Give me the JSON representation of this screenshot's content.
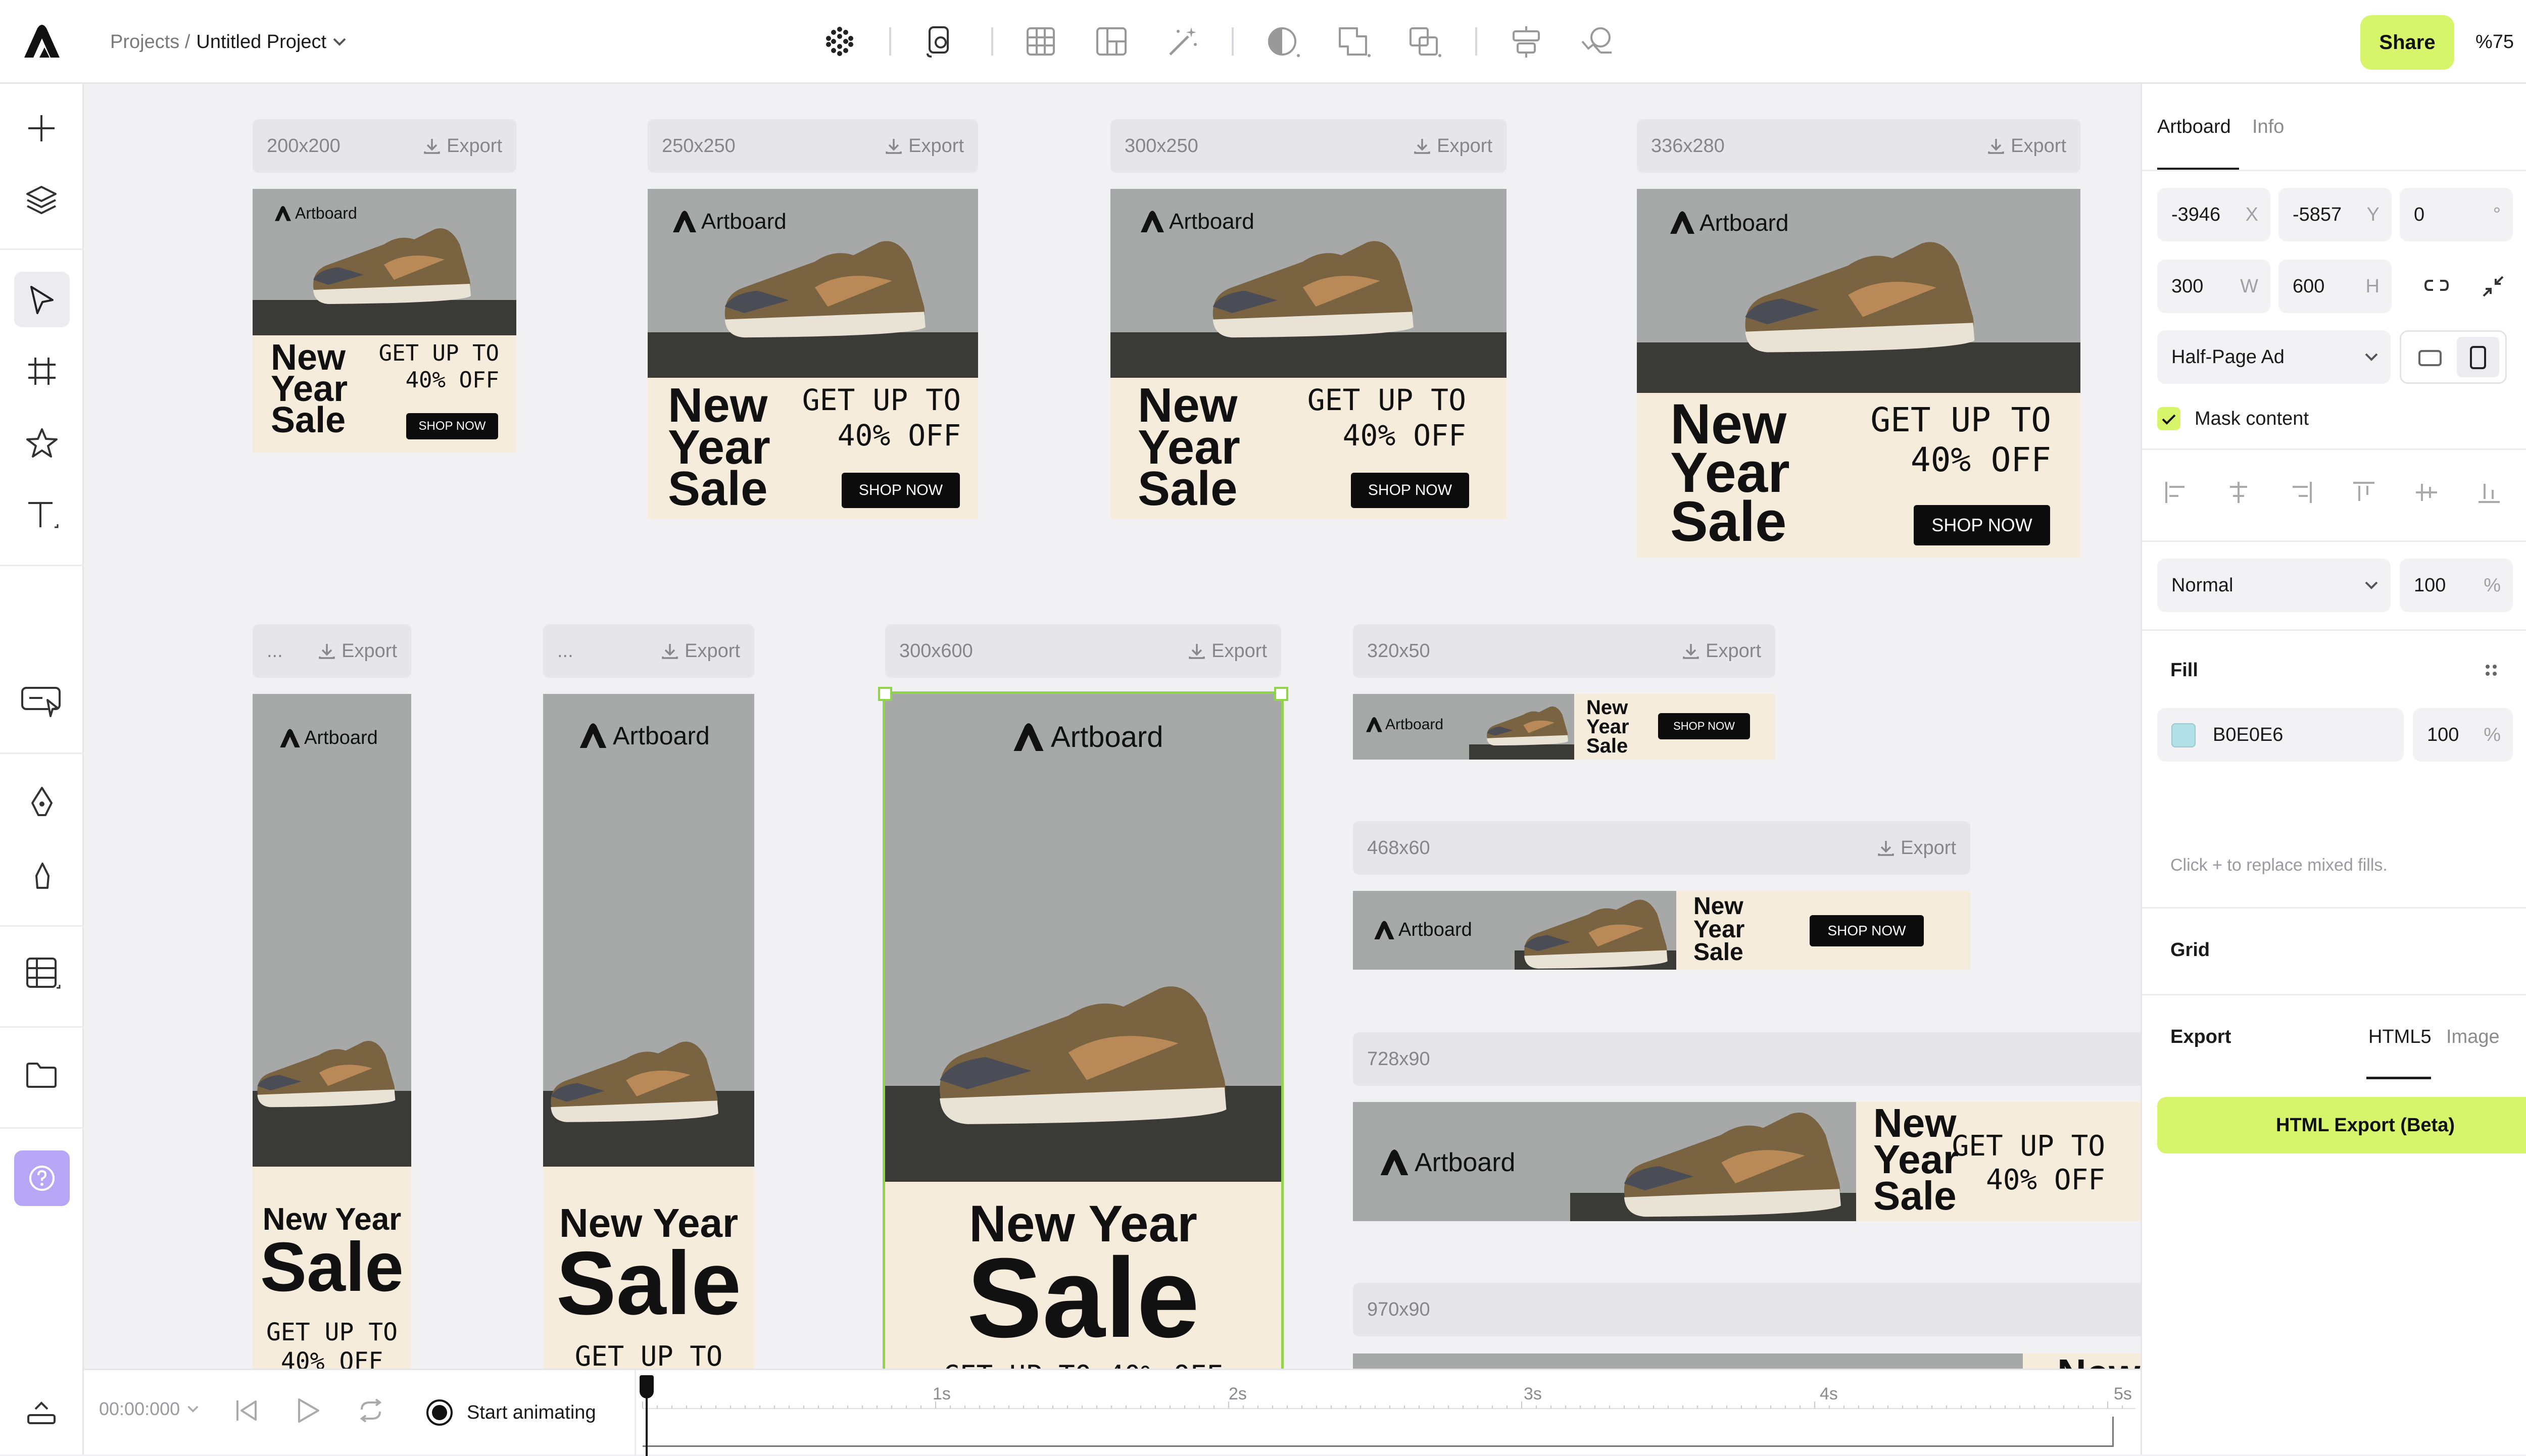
{
  "topbar": {
    "breadcrumb_root": "Projects /",
    "breadcrumb_current": "Untitled Project",
    "share_label": "Share",
    "zoom": "%75"
  },
  "colors": {
    "accent": "#d6f56a",
    "brand": "#111111",
    "fill_swatch": "#B0E0E6",
    "selection": "#8fd44a"
  },
  "artboards": [
    {
      "size": "200x200",
      "export": "Export"
    },
    {
      "size": "250x250",
      "export": "Export"
    },
    {
      "size": "300x250",
      "export": "Export"
    },
    {
      "size": "336x280",
      "export": "Export"
    },
    {
      "size": "...",
      "export": "Export"
    },
    {
      "size": "...",
      "export": "Export"
    },
    {
      "size": "300x600",
      "export": "Export"
    },
    {
      "size": "320x50",
      "export": "Export"
    },
    {
      "size": "468x60",
      "export": "Export"
    },
    {
      "size": "728x90",
      "export": ""
    },
    {
      "size": "970x90",
      "export": ""
    }
  ],
  "ad": {
    "brand": "Artboard",
    "line1": "New",
    "line2": "Year",
    "line3": "Sale",
    "new_year": "New Year",
    "offer1": "GET UP TO",
    "offer2": "40% OFF",
    "offer_full": "GET UP TO 40% OFF",
    "cta": "SHOP NOW",
    "cut_new": "New"
  },
  "panel": {
    "tab_artboard": "Artboard",
    "tab_info": "Info",
    "x": "-3946",
    "x_unit": "X",
    "y": "-5857",
    "y_unit": "Y",
    "rotation": "0",
    "rotation_unit": "°",
    "w": "300",
    "w_unit": "W",
    "h": "600",
    "h_unit": "H",
    "preset": "Half-Page Ad",
    "mask_label": "Mask content",
    "blend": "Normal",
    "opacity": "100",
    "opacity_unit": "%",
    "fill_title": "Fill",
    "fill_hex": "B0E0E6",
    "fill_opacity": "100",
    "fill_unit": "%",
    "fill_hint": "Click + to replace mixed fills.",
    "grid_title": "Grid",
    "export_title": "Export",
    "export_tab_html": "HTML5",
    "export_tab_image": "Image",
    "export_button": "HTML Export (Beta)"
  },
  "timeline": {
    "time": "00:00:000",
    "start_label": "Start animating",
    "ticks": [
      "1s",
      "2s",
      "3s",
      "4s",
      "5s"
    ]
  }
}
